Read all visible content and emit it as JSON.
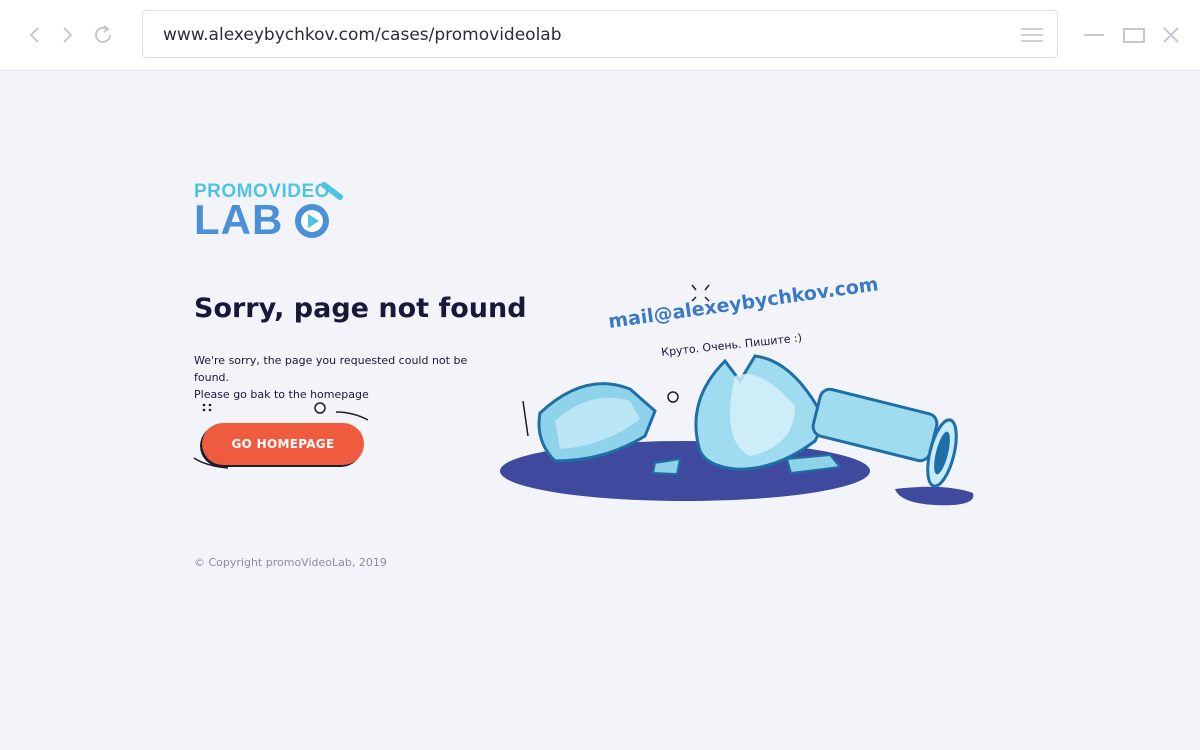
{
  "browser": {
    "url": "www.alexeybychkov.com/cases/promovideolab",
    "icons": [
      "chevron-left-icon",
      "chevron-right-icon",
      "reload-icon",
      "hamburger-menu-icon",
      "minimize-icon",
      "maximize-icon",
      "close-icon"
    ]
  },
  "logo": {
    "line1": "PROMOVIDEO",
    "line2": "LAB"
  },
  "error": {
    "title": "Sorry, page not found",
    "line1": "We're sorry, the page you requested could not be found.",
    "line2": "Please go bak to the homepage"
  },
  "cta": {
    "label": "GO HOMEPAGE"
  },
  "footer": {
    "copyright": "© Copyright promoVideoLab, 2019"
  },
  "overlay": {
    "email": "mail@alexeybychkov.com",
    "tagline": "Круто. Очень. Пишите :)"
  },
  "colors": {
    "accent": "#ee5b3e",
    "heading": "#17193a",
    "background": "#f3f4f9",
    "logo_blue": "#4a90d9",
    "logo_cyan": "#4fc3e6",
    "puddle": "#3f4a9e"
  }
}
